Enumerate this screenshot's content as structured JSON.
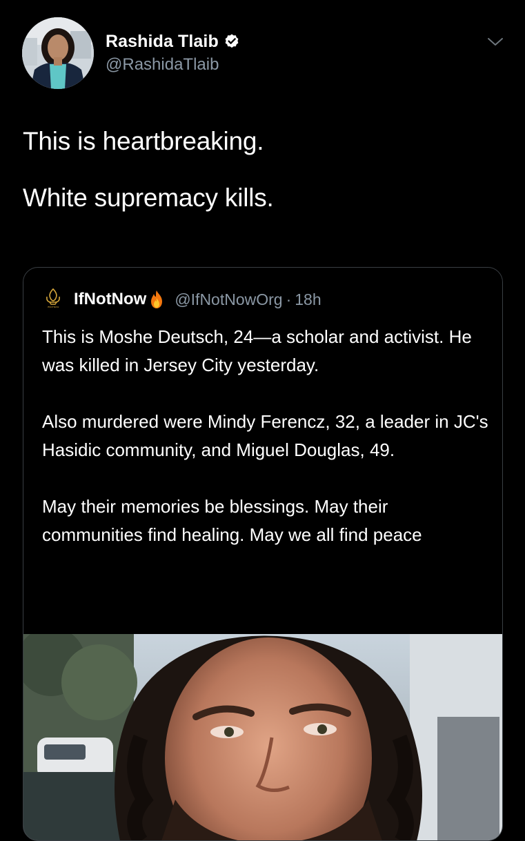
{
  "tweet": {
    "author": {
      "display_name": "Rashida Tlaib",
      "handle": "@RashidaTlaib",
      "verified": true,
      "avatar_icon": "profile-photo"
    },
    "text_lines": [
      "This is heartbreaking.",
      "White supremacy kills."
    ],
    "menu_icon": "chevron-down-icon"
  },
  "quoted_tweet": {
    "author": {
      "display_name": "IfNotNow",
      "name_emoji": "fire-emoji",
      "handle": "@IfNotNowOrg",
      "separator": "·",
      "time": "18h",
      "avatar_icon": "ifnotnow-logo",
      "logo_text": "IFNOTNOW"
    },
    "paragraphs": [
      "This is Moshe Deutsch, 24—a scholar and activist. He was killed in Jersey City yesterday.",
      "Also murdered were Mindy Ferencz, 32, a leader in JC's Hasidic community, and Miguel Douglas, 49.",
      "May their memories be blessings. May their communities find healing. May we all find peace"
    ],
    "media": {
      "type": "photo"
    }
  },
  "colors": {
    "background": "#000000",
    "text_primary": "#ffffff",
    "text_secondary": "#8b98a5",
    "border": "#3a3f44",
    "verified_badge": "#ffffff"
  }
}
